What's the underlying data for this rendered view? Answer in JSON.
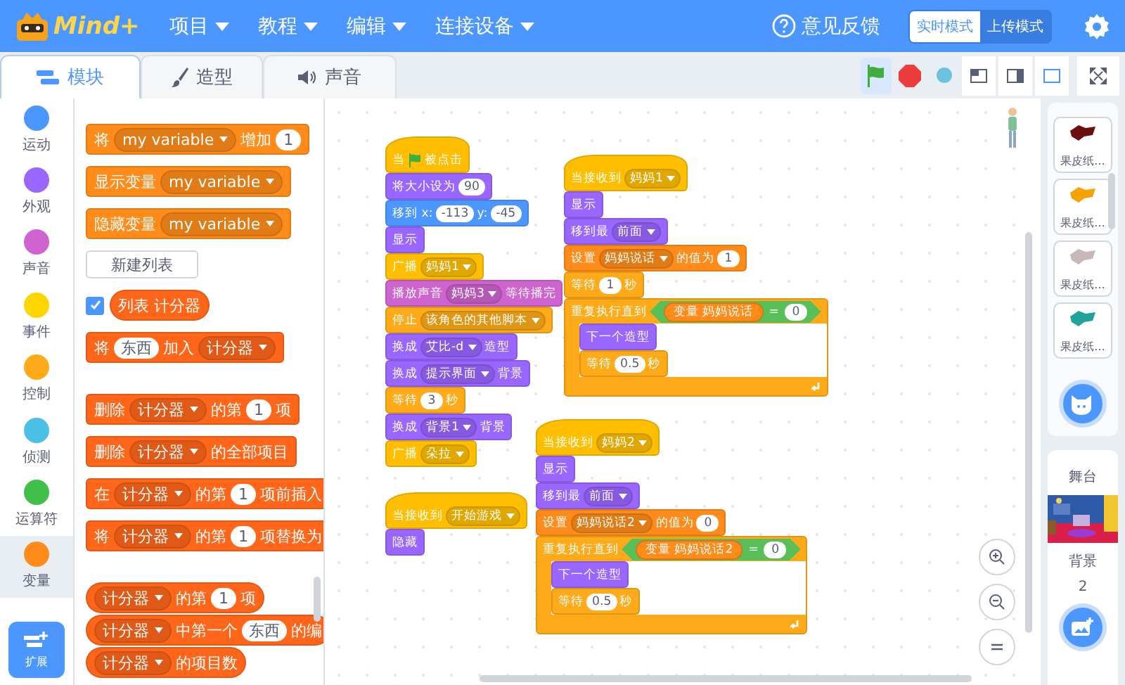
{
  "top_bar": {
    "logo": "Mind+",
    "menus": [
      "项目",
      "教程",
      "编辑",
      "连接设备"
    ],
    "feedback": "意见反馈",
    "modes": [
      {
        "label": "实时模式",
        "selected": true
      },
      {
        "label": "上传模式",
        "selected": false
      }
    ]
  },
  "tabs": [
    {
      "label": "模块",
      "selected": true
    },
    {
      "label": "造型",
      "selected": false
    },
    {
      "label": "声音",
      "selected": false
    }
  ],
  "layout_buttons": [
    {
      "selected": false
    },
    {
      "selected": false
    },
    {
      "selected": true
    }
  ],
  "categories": [
    {
      "label": "运动",
      "color": "#4c97ff",
      "selected": false
    },
    {
      "label": "外观",
      "color": "#9966ff",
      "selected": false
    },
    {
      "label": "声音",
      "color": "#cf63cf",
      "selected": false
    },
    {
      "label": "事件",
      "color": "#ffd500",
      "selected": false
    },
    {
      "label": "控制",
      "color": "#ffab19",
      "selected": false
    },
    {
      "label": "侦测",
      "color": "#4cbfe6",
      "selected": false
    },
    {
      "label": "运算符",
      "color": "#40bf4a",
      "selected": false
    },
    {
      "label": "变量",
      "color": "#ff8c1a",
      "selected": true
    }
  ],
  "extension_button": "扩展",
  "palette": {
    "sections": [
      [
        {
          "kind": "stack",
          "color": "#ff8c1a",
          "parts": [
            {
              "kind": "label",
              "text": "将"
            },
            {
              "kind": "menu",
              "text": "my variable"
            },
            {
              "kind": "label",
              "text": "增加"
            },
            {
              "kind": "number",
              "text": "1"
            }
          ]
        },
        {
          "kind": "stack",
          "color": "#ff8c1a",
          "parts": [
            {
              "kind": "label",
              "text": "显示变量"
            },
            {
              "kind": "menu",
              "text": "my variable"
            }
          ]
        },
        {
          "kind": "stack",
          "color": "#ff8c1a",
          "parts": [
            {
              "kind": "label",
              "text": "隐藏变量"
            },
            {
              "kind": "menu",
              "text": "my variable"
            }
          ]
        },
        {
          "kind": "button",
          "label": "新建列表"
        },
        {
          "kind": "monitor",
          "checked": true,
          "block": {
            "kind": "reporter",
            "color": "#ff661a",
            "parts": [
              {
                "kind": "label",
                "text": "列表 计分器"
              }
            ]
          }
        },
        {
          "kind": "stack",
          "color": "#ff661a",
          "parts": [
            {
              "kind": "label",
              "text": "将"
            },
            {
              "kind": "text",
              "text": "东西"
            },
            {
              "kind": "label",
              "text": "加入"
            },
            {
              "kind": "menu",
              "text": "计分器"
            }
          ]
        }
      ],
      [
        {
          "kind": "stack",
          "color": "#ff661a",
          "parts": [
            {
              "kind": "label",
              "text": "删除"
            },
            {
              "kind": "menu",
              "text": "计分器"
            },
            {
              "kind": "label",
              "text": "的第"
            },
            {
              "kind": "number",
              "text": "1"
            },
            {
              "kind": "label",
              "text": "项"
            }
          ]
        },
        {
          "kind": "stack",
          "color": "#ff661a",
          "parts": [
            {
              "kind": "label",
              "text": "删除"
            },
            {
              "kind": "menu",
              "text": "计分器"
            },
            {
              "kind": "label",
              "text": "的全部项目"
            }
          ]
        },
        {
          "kind": "stack",
          "color": "#ff661a",
          "parts": [
            {
              "kind": "label",
              "text": "在"
            },
            {
              "kind": "menu",
              "text": "计分器"
            },
            {
              "kind": "label",
              "text": "的第"
            },
            {
              "kind": "number",
              "text": "1"
            },
            {
              "kind": "label",
              "text": "项前插入"
            }
          ]
        },
        {
          "kind": "stack",
          "color": "#ff661a",
          "parts": [
            {
              "kind": "label",
              "text": "将"
            },
            {
              "kind": "menu",
              "text": "计分器"
            },
            {
              "kind": "label",
              "text": "的第"
            },
            {
              "kind": "number",
              "text": "1"
            },
            {
              "kind": "label",
              "text": "项替换为"
            }
          ]
        }
      ],
      [
        {
          "kind": "reporter",
          "color": "#ff661a",
          "parts": [
            {
              "kind": "menu",
              "text": "计分器"
            },
            {
              "kind": "label",
              "text": "的第"
            },
            {
              "kind": "number",
              "text": "1"
            },
            {
              "kind": "label",
              "text": "项"
            }
          ]
        },
        {
          "kind": "reporter",
          "color": "#ff661a",
          "parts": [
            {
              "kind": "menu",
              "text": "计分器"
            },
            {
              "kind": "label",
              "text": "中第一个"
            },
            {
              "kind": "text",
              "text": "东西"
            },
            {
              "kind": "label",
              "text": "的编"
            }
          ]
        },
        {
          "kind": "reporter",
          "color": "#ff661a",
          "parts": [
            {
              "kind": "menu",
              "text": "计分器"
            },
            {
              "kind": "label",
              "text": "的项目数"
            }
          ]
        }
      ]
    ]
  },
  "scripts": [
    {
      "blocks": [
        {
          "kind": "hat",
          "color": "#ffbf00",
          "parts": [
            {
              "kind": "label",
              "text": "当"
            },
            {
              "kind": "flag"
            },
            {
              "kind": "label",
              "text": "被点击"
            }
          ]
        },
        {
          "kind": "stack",
          "color": "#9966ff",
          "parts": [
            {
              "kind": "label",
              "text": "将大小设为"
            },
            {
              "kind": "number",
              "text": "90"
            }
          ]
        },
        {
          "kind": "stack",
          "color": "#4c97ff",
          "parts": [
            {
              "kind": "label",
              "text": "移到 x:"
            },
            {
              "kind": "number",
              "text": "-113"
            },
            {
              "kind": "label",
              "text": "y:"
            },
            {
              "kind": "number",
              "text": "-45"
            }
          ]
        },
        {
          "kind": "stack",
          "color": "#9966ff",
          "parts": [
            {
              "kind": "label",
              "text": "显示"
            }
          ]
        },
        {
          "kind": "stack",
          "color": "#ffbf00",
          "parts": [
            {
              "kind": "label",
              "text": "广播"
            },
            {
              "kind": "menu",
              "text": "妈妈1"
            }
          ]
        },
        {
          "kind": "stack",
          "color": "#cf63cf",
          "parts": [
            {
              "kind": "label",
              "text": "播放声音"
            },
            {
              "kind": "menu",
              "text": "妈妈3"
            },
            {
              "kind": "label",
              "text": "等待播完"
            }
          ]
        },
        {
          "kind": "stack",
          "color": "#ffab19",
          "parts": [
            {
              "kind": "label",
              "text": "停止"
            },
            {
              "kind": "menu",
              "text": "该角色的其他脚本"
            }
          ]
        },
        {
          "kind": "stack",
          "color": "#9966ff",
          "parts": [
            {
              "kind": "label",
              "text": "换成"
            },
            {
              "kind": "menu",
              "text": "艾比-d"
            },
            {
              "kind": "label",
              "text": "造型"
            }
          ]
        },
        {
          "kind": "stack",
          "color": "#9966ff",
          "parts": [
            {
              "kind": "label",
              "text": "换成"
            },
            {
              "kind": "menu",
              "text": "提示界面"
            },
            {
              "kind": "label",
              "text": "背景"
            }
          ]
        },
        {
          "kind": "stack",
          "color": "#ffab19",
          "parts": [
            {
              "kind": "label",
              "text": "等待"
            },
            {
              "kind": "number",
              "text": "3"
            },
            {
              "kind": "label",
              "text": "秒"
            }
          ]
        },
        {
          "kind": "stack",
          "color": "#9966ff",
          "parts": [
            {
              "kind": "label",
              "text": "换成"
            },
            {
              "kind": "menu",
              "text": "背景1"
            },
            {
              "kind": "label",
              "text": "背景"
            }
          ]
        },
        {
          "kind": "stack",
          "color": "#ffbf00",
          "parts": [
            {
              "kind": "label",
              "text": "广播"
            },
            {
              "kind": "menu",
              "text": "朵拉"
            }
          ]
        }
      ]
    },
    {
      "blocks": [
        {
          "kind": "hat",
          "color": "#ffbf00",
          "parts": [
            {
              "kind": "label",
              "text": "当接收到"
            },
            {
              "kind": "menu",
              "text": "妈妈1"
            }
          ]
        },
        {
          "kind": "stack",
          "color": "#9966ff",
          "parts": [
            {
              "kind": "label",
              "text": "显示"
            }
          ]
        },
        {
          "kind": "stack",
          "color": "#9966ff",
          "parts": [
            {
              "kind": "label",
              "text": "移到最"
            },
            {
              "kind": "menu",
              "text": "前面"
            }
          ]
        },
        {
          "kind": "stack",
          "color": "#ff8c1a",
          "parts": [
            {
              "kind": "label",
              "text": "设置"
            },
            {
              "kind": "menu",
              "text": "妈妈说话"
            },
            {
              "kind": "label",
              "text": "的值为"
            },
            {
              "kind": "number",
              "text": "1"
            }
          ]
        },
        {
          "kind": "stack",
          "color": "#ffab19",
          "parts": [
            {
              "kind": "label",
              "text": "等待"
            },
            {
              "kind": "number",
              "text": "1"
            },
            {
              "kind": "label",
              "text": "秒"
            }
          ]
        },
        {
          "kind": "c",
          "color": "#ffab19",
          "parts": [
            {
              "kind": "label",
              "text": "重复执行直到"
            },
            {
              "kind": "boolean",
              "color": "#59c059",
              "parts": [
                {
                  "kind": "reporter",
                  "color": "#ff8c1a",
                  "parts": [
                    {
                      "kind": "label",
                      "text": "变量 妈妈说话"
                    }
                  ]
                },
                {
                  "kind": "label",
                  "text": "="
                },
                {
                  "kind": "number",
                  "text": "0"
                }
              ]
            }
          ],
          "body": [
            {
              "kind": "stack",
              "color": "#9966ff",
              "parts": [
                {
                  "kind": "label",
                  "text": "下一个造型"
                }
              ]
            },
            {
              "kind": "stack",
              "color": "#ffab19",
              "parts": [
                {
                  "kind": "label",
                  "text": "等待"
                },
                {
                  "kind": "number",
                  "text": "0.5"
                },
                {
                  "kind": "label",
                  "text": "秒"
                }
              ]
            }
          ]
        }
      ]
    },
    {
      "blocks": [
        {
          "kind": "hat",
          "color": "#ffbf00",
          "parts": [
            {
              "kind": "label",
              "text": "当接收到"
            },
            {
              "kind": "menu",
              "text": "开始游戏"
            }
          ]
        },
        {
          "kind": "stack",
          "color": "#9966ff",
          "parts": [
            {
              "kind": "label",
              "text": "隐藏"
            }
          ]
        }
      ]
    },
    {
      "blocks": [
        {
          "kind": "hat",
          "color": "#ffbf00",
          "parts": [
            {
              "kind": "label",
              "text": "当接收到"
            },
            {
              "kind": "menu",
              "text": "妈妈2"
            }
          ]
        },
        {
          "kind": "stack",
          "color": "#9966ff",
          "parts": [
            {
              "kind": "label",
              "text": "显示"
            }
          ]
        },
        {
          "kind": "stack",
          "color": "#9966ff",
          "parts": [
            {
              "kind": "label",
              "text": "移到最"
            },
            {
              "kind": "menu",
              "text": "前面"
            }
          ]
        },
        {
          "kind": "stack",
          "color": "#ff8c1a",
          "parts": [
            {
              "kind": "label",
              "text": "设置"
            },
            {
              "kind": "menu",
              "text": "妈妈说话2"
            },
            {
              "kind": "label",
              "text": "的值为"
            },
            {
              "kind": "number",
              "text": "0"
            }
          ]
        },
        {
          "kind": "c",
          "color": "#ffab19",
          "parts": [
            {
              "kind": "label",
              "text": "重复执行直到"
            },
            {
              "kind": "boolean",
              "color": "#59c059",
              "parts": [
                {
                  "kind": "reporter",
                  "color": "#ff8c1a",
                  "parts": [
                    {
                      "kind": "label",
                      "text": "变量 妈妈说话2"
                    }
                  ]
                },
                {
                  "kind": "label",
                  "text": "="
                },
                {
                  "kind": "number",
                  "text": "0"
                }
              ]
            }
          ],
          "body": [
            {
              "kind": "stack",
              "color": "#9966ff",
              "parts": [
                {
                  "kind": "label",
                  "text": "下一个造型"
                }
              ]
            },
            {
              "kind": "stack",
              "color": "#ffab19",
              "parts": [
                {
                  "kind": "label",
                  "text": "等待"
                },
                {
                  "kind": "number",
                  "text": "0.5"
                },
                {
                  "kind": "label",
                  "text": "秒"
                }
              ]
            }
          ]
        }
      ]
    }
  ],
  "sprites": [
    {
      "label": "果皮纸..."
    },
    {
      "label": "果皮纸..."
    },
    {
      "label": "果皮纸..."
    },
    {
      "label": "果皮纸..."
    }
  ],
  "stage": {
    "title": "舞台",
    "backdrop_label": "背景",
    "backdrop_count": "2"
  }
}
